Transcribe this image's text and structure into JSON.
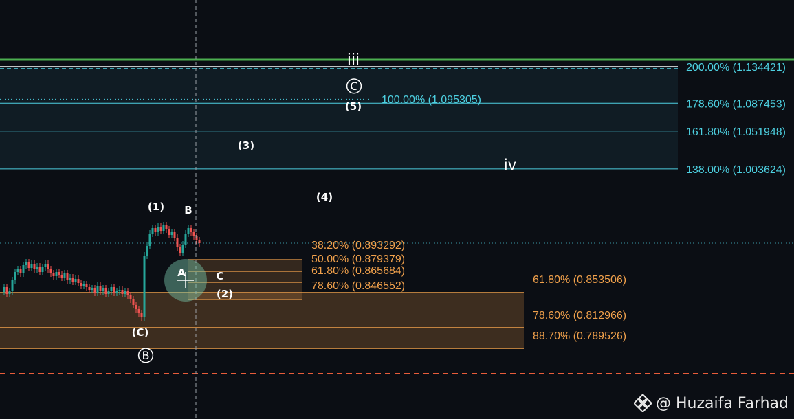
{
  "chart_data": {
    "type": "candlestick",
    "price_range": [
      0.745,
      1.16
    ],
    "colors": {
      "up": "#26a69a",
      "down": "#ef5350",
      "background": "#0b0e14",
      "green_line": "#4caf50",
      "cyan": "#4dd0e1",
      "orange": "#f0a04b",
      "red_dashed": "#e85c3a",
      "text": "#ffffff"
    },
    "horizontal_lines": [
      {
        "price": 1.143,
        "color": "#4caf50",
        "style": "solid"
      },
      {
        "price": 0.742,
        "color": "#e85c3a",
        "style": "dashed"
      },
      {
        "price": 0.893292,
        "color": "#4dd0e1",
        "style": "dotted"
      }
    ],
    "fib_extension_levels": [
      {
        "label": "200.00% (1.134421)",
        "price": 1.134421
      },
      {
        "label": "178.60% (1.087453)",
        "price": 1.087453
      },
      {
        "label": "161.80% (1.051948)",
        "price": 1.051948
      },
      {
        "label": "138.00% (1.003624)",
        "price": 1.003624
      }
    ],
    "fib_extension_100": {
      "label": "100.00% (1.095305)",
      "price": 1.095305
    },
    "fib_retracement_small": [
      {
        "label": "38.20% (0.893292)",
        "price": 0.8755
      },
      {
        "label": "50.00% (0.879379)",
        "price": 0.8755
      },
      {
        "label": "61.80% (0.865684)",
        "price": 0.8619
      },
      {
        "label": "78.60% (0.846552)",
        "price": 0.8479
      }
    ],
    "fib_retracement_large": [
      {
        "label": "61.80% (0.853506)",
        "price": 0.8461
      },
      {
        "label": "78.60% (0.812966)",
        "price": 0.7954
      },
      {
        "label": "88.70% (0.789526)",
        "price": 0.7655
      }
    ],
    "wave_labels": [
      "iii",
      "C",
      "(5)",
      "(3)",
      "iv",
      "(4)",
      "(1)",
      "B",
      "A",
      "C",
      "(2)",
      "(C)",
      "B"
    ],
    "cursor": {
      "vertical_line": true
    }
  },
  "watermark": {
    "text": "@ Huzaifa Farhad"
  }
}
